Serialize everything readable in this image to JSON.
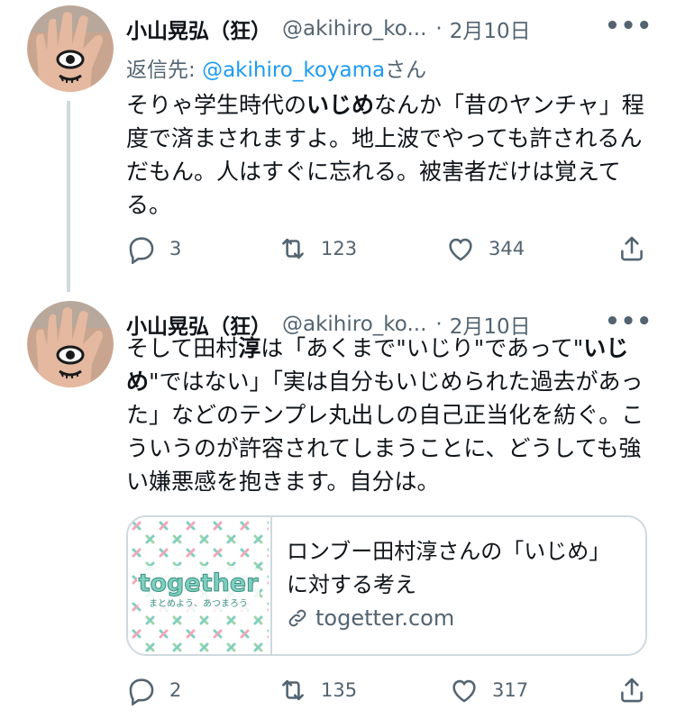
{
  "tweet1": {
    "author_name": "小山晃弘（狂）",
    "handle": "@akihiro_ko...",
    "separator": "·",
    "date": "2月10日",
    "more": "•••",
    "reply_prefix": "返信先: ",
    "reply_mention": "@akihiro_koyama",
    "reply_suffix": "さん",
    "text_1": "そりゃ学生時代の",
    "text_bold": "いじめ",
    "text_2": "なんか「昔のヤンチャ」程度で済まされますよ。地上波でやっても許されるんだもん。人はすぐに忘れる。被害者だけは覚えてる。",
    "replies": "3",
    "retweets": "123",
    "likes": "344"
  },
  "tweet2": {
    "author_name": "小山晃弘（狂）",
    "handle": "@akihiro_ko...",
    "separator": "·",
    "date": "2月10日",
    "more": "•••",
    "text_1": "そして田村",
    "text_bold_1": "淳",
    "text_2": "は「あくまで\"いじり\"であって\"",
    "text_bold_2": "いじめ",
    "text_3": "\"ではない」「実は自分もいじめられた過去があった」などのテンプレ丸出しの自己正当化を紡ぐ。こういうのが許容されてしまうことに、どうしても強い嫌悪感を抱きます。自分は。",
    "card": {
      "image_logo": "together",
      "image_tagline": "まとめよう、あつまろう",
      "title": "ロンブー田村淳さんの「いじめ」に対する考え",
      "domain": "togetter.com"
    },
    "replies": "2",
    "retweets": "135",
    "likes": "317"
  },
  "colors": {
    "text": "#0f1419",
    "secondary": "#536471",
    "link": "#1d9bf0",
    "border": "#cfd9de",
    "logo_teal": "#7fcfc0"
  },
  "icons": [
    "reply-icon",
    "retweet-icon",
    "like-icon",
    "share-icon",
    "link-icon",
    "more-icon"
  ]
}
